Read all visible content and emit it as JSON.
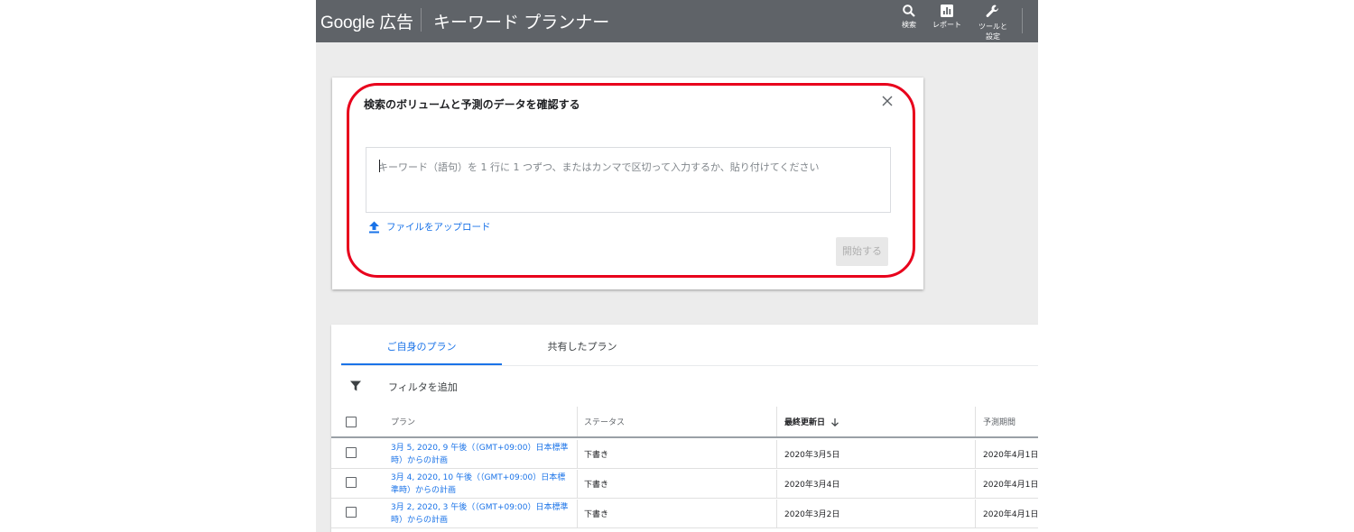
{
  "header": {
    "brand": "Google 広告",
    "title": "キーワード プランナー",
    "actions": [
      {
        "label": "検索",
        "icon": "search-icon"
      },
      {
        "label": "レポート",
        "icon": "report-icon"
      },
      {
        "label": "ツールと\n設定",
        "icon": "wrench-icon"
      }
    ]
  },
  "dialog": {
    "title": "検索のボリュームと予測のデータを確認する",
    "input_placeholder": "キーワード（語句）を 1 行に 1 つずつ、またはカンマで区切って入力するか、貼り付けてください",
    "upload_label": "ファイルをアップロード",
    "start_label": "開始する"
  },
  "plans": {
    "tabs": [
      {
        "label": "ご自身のプラン",
        "active": true
      },
      {
        "label": "共有したプラン",
        "active": false
      }
    ],
    "filter_label": "フィルタを追加",
    "columns": [
      "プラン",
      "ステータス",
      "最終更新日",
      "予測期間"
    ],
    "rows": [
      {
        "plan": "3月 5, 2020, 9 午後（（GMT+09:00）日本標準時）からの計画",
        "status": "下書き",
        "updated": "2020年3月5日",
        "period": "2020年4月1日"
      },
      {
        "plan": "3月 4, 2020, 10 午後（（GMT+09:00）日本標準時）からの計画",
        "status": "下書き",
        "updated": "2020年3月4日",
        "period": "2020年4月1日"
      },
      {
        "plan": "3月 2, 2020, 3 午後（（GMT+09:00）日本標準時）からの計画",
        "status": "下書き",
        "updated": "2020年3月2日",
        "period": "2020年4月1日"
      }
    ]
  },
  "colors": {
    "topbar": "#5f6368",
    "accent": "#1a73e8",
    "highlight": "#e8001c"
  }
}
